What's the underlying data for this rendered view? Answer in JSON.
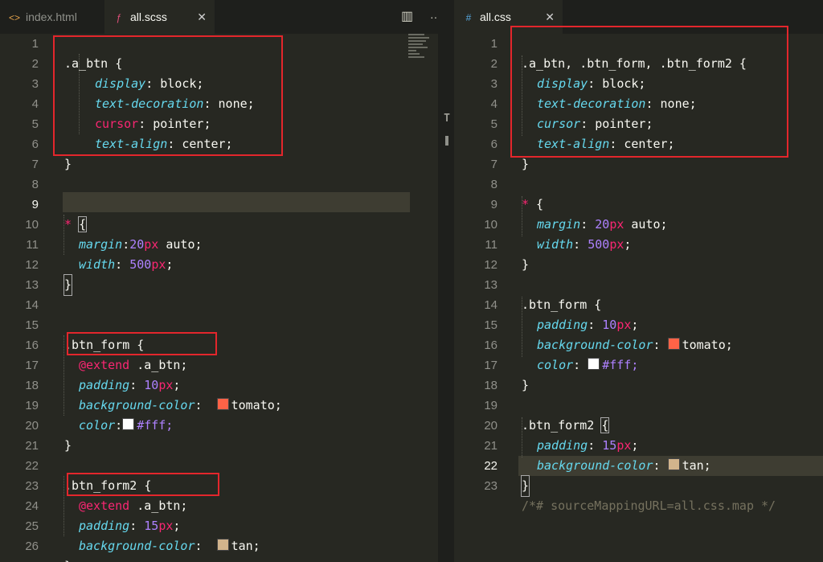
{
  "left_pane": {
    "tabs": [
      {
        "icon": "<>",
        "label": "index.html"
      },
      {
        "icon": "ƒ",
        "label": "all.scss"
      }
    ],
    "active_close": "✕",
    "split_icon": "▥",
    "more_icon": "···",
    "lines": [
      {
        "n": "1"
      },
      {
        "n": "2"
      },
      {
        "n": "3"
      },
      {
        "n": "4"
      },
      {
        "n": "5"
      },
      {
        "n": "6"
      },
      {
        "n": "7"
      },
      {
        "n": "8"
      },
      {
        "n": "9"
      },
      {
        "n": "10"
      },
      {
        "n": "11"
      },
      {
        "n": "12"
      },
      {
        "n": "13"
      },
      {
        "n": "14"
      },
      {
        "n": "15"
      },
      {
        "n": "16"
      },
      {
        "n": "17"
      },
      {
        "n": "18"
      },
      {
        "n": "19"
      },
      {
        "n": "20"
      },
      {
        "n": "21"
      },
      {
        "n": "22"
      },
      {
        "n": "23"
      },
      {
        "n": "24"
      },
      {
        "n": "25"
      },
      {
        "n": "26"
      }
    ],
    "code": {
      "l1_sel": ".a_btn",
      "l1_brace": " {",
      "p_display": "display",
      "v_block": " block;",
      "p_textdec": "text-decoration",
      "v_none": " none;",
      "p_cursor": "cursor",
      "v_pointer": " pointer;",
      "p_textalign": "text-align",
      "v_center": " center;",
      "close": "}",
      "star": "*",
      "open": " {",
      "open_cur": "{",
      "p_margin": "margin",
      "v_margin_num": "20",
      "v_margin_unit": "px",
      "v_auto": " auto;",
      "p_width": "width",
      "v_500": "500",
      "v_px": "px",
      "semi": ";",
      "colon": ":",
      "btn_form": ".btn_form",
      "extend": "@extend",
      "extend_target": " .a_btn;",
      "p_padding": "padding",
      "v_10": "10",
      "v_15": "15",
      "p_bg": "background-color",
      "v_tomato": "tomato;",
      "p_color": "color",
      "v_fff": "#fff;",
      "btn_form2": ".btn_form2",
      "v_tan": "tan;"
    }
  },
  "right_pane": {
    "tab": {
      "icon": "#",
      "label": "all.css"
    },
    "close": "✕",
    "lines": [
      {
        "n": "1"
      },
      {
        "n": "2"
      },
      {
        "n": "3"
      },
      {
        "n": "4"
      },
      {
        "n": "5"
      },
      {
        "n": "6"
      },
      {
        "n": "7"
      },
      {
        "n": "8"
      },
      {
        "n": "9"
      },
      {
        "n": "10"
      },
      {
        "n": "11"
      },
      {
        "n": "12"
      },
      {
        "n": "13"
      },
      {
        "n": "14"
      },
      {
        "n": "15"
      },
      {
        "n": "16"
      },
      {
        "n": "17"
      },
      {
        "n": "18"
      },
      {
        "n": "19"
      },
      {
        "n": "20"
      },
      {
        "n": "21"
      },
      {
        "n": "22"
      },
      {
        "n": "23"
      }
    ],
    "code": {
      "l1": ".a_btn, .btn_form, .btn_form2 {",
      "source_map": "/*# sourceMappingURL=all.css.map */"
    }
  },
  "colors": {
    "tomato": "#ff6347",
    "white": "#ffffff",
    "tan": "#d2b48c",
    "annotation_red": "#e3262c"
  }
}
